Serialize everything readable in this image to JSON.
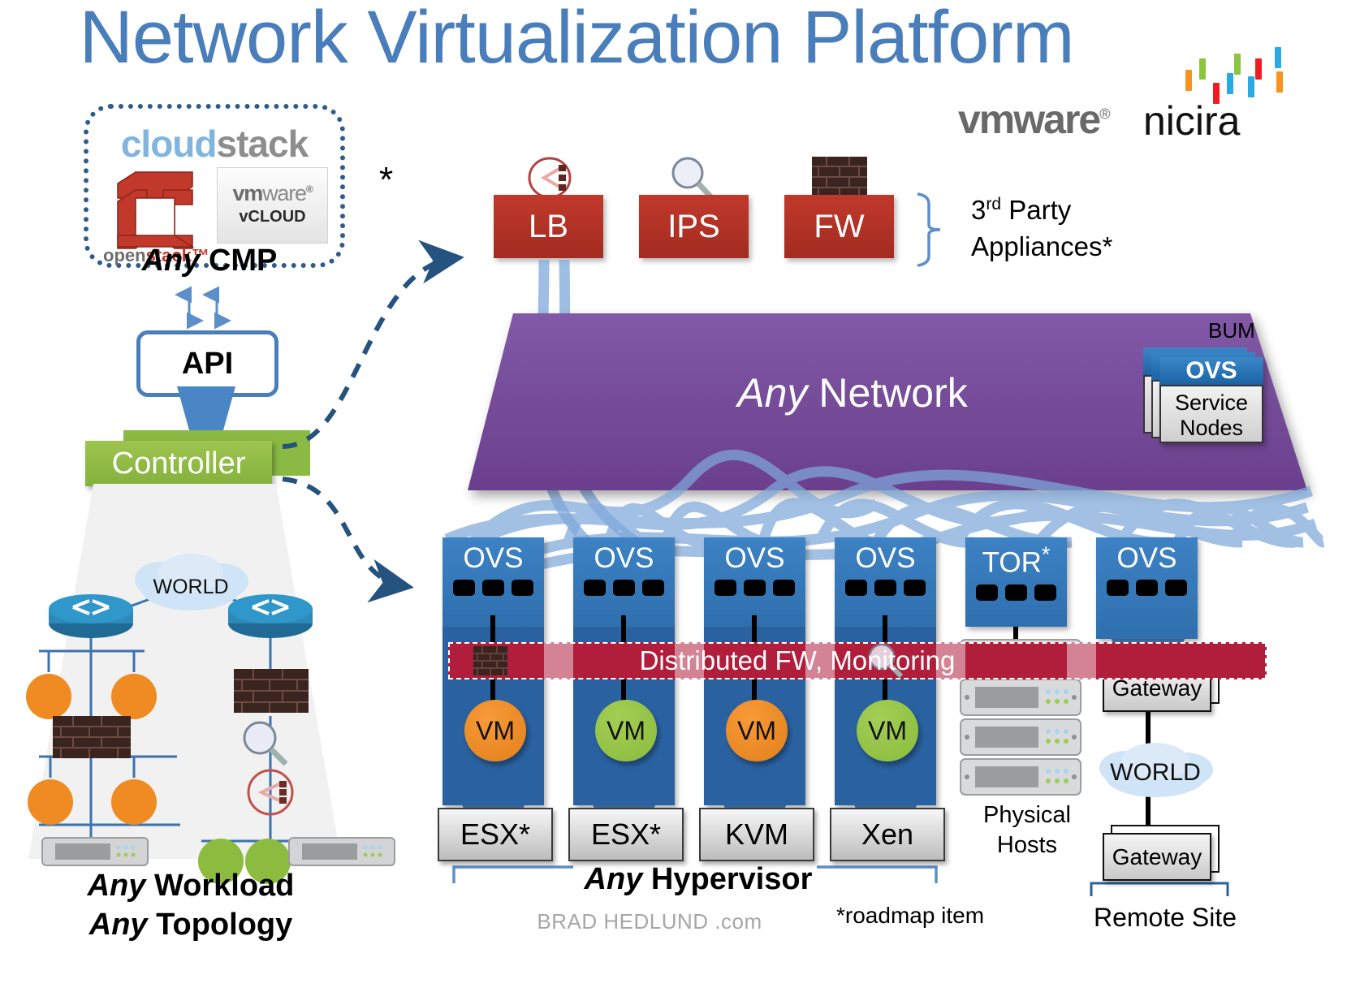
{
  "title": "Network Virtualization Platform",
  "brand": {
    "vmware": "vmware",
    "vmware_reg": "®",
    "nicira": "nicira",
    "nicira_bar_colors": [
      "#8cc63f",
      "#f7941e",
      "#29abe2",
      "#ed1c24",
      "#8cc63f",
      "#f7941e",
      "#29abe2",
      "#ed1c24"
    ]
  },
  "cmp": {
    "cloudstack_cloud": "cloud",
    "cloudstack_stack": "stack",
    "openstack_open": "open",
    "openstack_stack": "stack™",
    "vcloud_vm": "vm",
    "vcloud_ware": "ware",
    "vcloud_reg": "®",
    "vcloud_line2": "vCLOUD",
    "star": "*",
    "label_any": "Any",
    "label_rest": " CMP"
  },
  "api": {
    "label": "API"
  },
  "controller": {
    "label": "Controller"
  },
  "workload": {
    "cloud_label": "WORLD",
    "label1_any": "Any",
    "label1_rest": " Workload",
    "label2_any": "Any",
    "label2_rest": " Topology"
  },
  "appliances": {
    "items": [
      {
        "label": "LB",
        "icon": "load-balancer-icon"
      },
      {
        "label": "IPS",
        "icon": "magnifier-icon"
      },
      {
        "label": "FW",
        "icon": "brick-wall-icon"
      }
    ],
    "bracket_line1_prefix": "3",
    "bracket_line1_sup": "rd",
    "bracket_line1_rest": " Party",
    "bracket_line2": "Appliances*"
  },
  "network_plane": {
    "label_any": "Any",
    "label_rest": " Network",
    "color": "#7d519c"
  },
  "service_nodes": {
    "bum_label": "BUM",
    "header": "OVS",
    "body_line1": "Service",
    "body_line2": "Nodes"
  },
  "switch_columns": [
    {
      "header": "OVS",
      "star": "",
      "vm": "VM",
      "vm_color": "orange",
      "hypervisor": "ESX*"
    },
    {
      "header": "OVS",
      "star": "",
      "vm": "VM",
      "vm_color": "green",
      "hypervisor": "ESX*"
    },
    {
      "header": "OVS",
      "star": "",
      "vm": "VM",
      "vm_color": "orange",
      "hypervisor": "KVM"
    },
    {
      "header": "OVS",
      "star": "",
      "vm": "VM",
      "vm_color": "green",
      "hypervisor": "Xen"
    },
    {
      "header": "TOR",
      "star": "*",
      "vm": "",
      "vm_color": "",
      "hypervisor": ""
    },
    {
      "header": "OVS",
      "star": "",
      "vm": "",
      "vm_color": "",
      "hypervisor": ""
    }
  ],
  "dfw_band": {
    "label": "Distributed FW, Monitoring",
    "color": "#b01e3c"
  },
  "physical_hosts": {
    "line1": "Physical",
    "line2": "Hosts",
    "count": 4
  },
  "gateways": {
    "top_label": "Gateway",
    "cloud_label": "WORLD",
    "bottom_label": "Gateway",
    "site_label": "Remote Site"
  },
  "footer": {
    "any_hyp_any": "Any",
    "any_hyp_rest": " Hypervisor",
    "credit": "BRAD HEDLUND .com",
    "roadmap": "*roadmap item"
  }
}
